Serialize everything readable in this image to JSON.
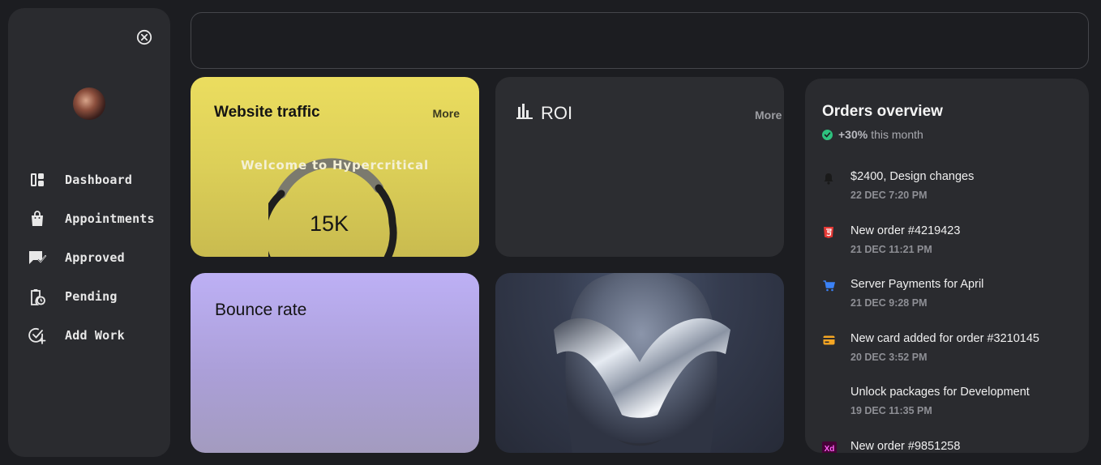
{
  "sidebar": {
    "items": [
      {
        "label": "Dashboard",
        "icon": "dashboard-icon"
      },
      {
        "label": "Appointments",
        "icon": "shopping-bag-icon"
      },
      {
        "label": "Approved",
        "icon": "chat-check-icon"
      },
      {
        "label": "Pending",
        "icon": "clipboard-clock-icon"
      },
      {
        "label": "Add Work",
        "icon": "check-plus-icon"
      }
    ]
  },
  "cards": {
    "traffic": {
      "title": "Website traffic",
      "more": "More",
      "welcome": "Welcome to Hypercritical",
      "value": "15K"
    },
    "roi": {
      "title": "ROI",
      "more": "More"
    },
    "bounce": {
      "title": "Bounce rate"
    }
  },
  "orders": {
    "title": "Orders overview",
    "change": "+30%",
    "period": "this month",
    "items": [
      {
        "title": "$2400, Design changes",
        "date": "22 DEC 7:20 PM",
        "icon": "bell-icon",
        "color": "#1a1a1a"
      },
      {
        "title": "New order #4219423",
        "date": "21 DEC 11:21 PM",
        "icon": "html5-icon",
        "color": "#e53935"
      },
      {
        "title": "Server Payments for April",
        "date": "21 DEC 9:28 PM",
        "icon": "cart-icon",
        "color": "#3b82f6"
      },
      {
        "title": "New card added for order #3210145",
        "date": "20 DEC 3:52 PM",
        "icon": "credit-card-icon",
        "color": "#f5a623"
      },
      {
        "title": "Unlock packages for Development",
        "date": "19 DEC 11:35 PM",
        "icon": "key-icon",
        "color": "#2a2b2f"
      },
      {
        "title": "New order #9851258",
        "date": "",
        "icon": "adobe-xd-icon",
        "color": "#ff26be"
      }
    ]
  },
  "colors": {
    "accent_yellow": "#ebdd5f",
    "accent_purple": "#bdb0f5",
    "success": "#2ec27e"
  }
}
